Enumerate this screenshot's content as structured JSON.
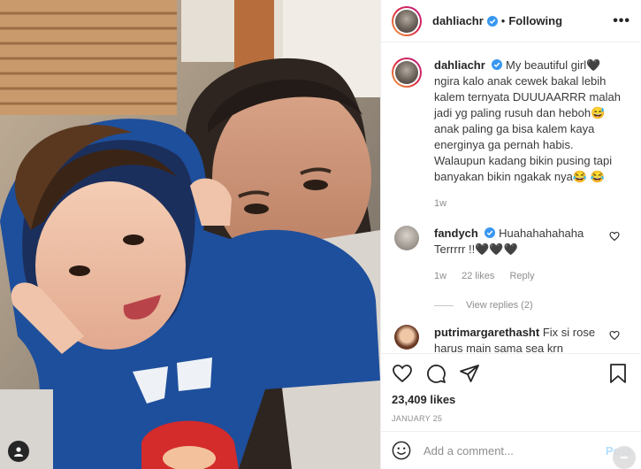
{
  "post": {
    "username": "dahliachr",
    "follow_status": "Following",
    "more_label": "•••",
    "caption": "My beautiful girl🖤 ngira kalo anak cewek bakal lebih kalem ternyata DUUUAARRR malah jadi yg paling rusuh dan heboh😅 anak paling ga bisa kalem kaya energinya ga pernah habis. Walaupun kadang bikin pusing tapi banyakan bikin ngakak nya😂 😂",
    "caption_time": "1w"
  },
  "comments": [
    {
      "username": "fandych",
      "text": "Huahahahahaha Terrrrr !!🖤🖤🖤",
      "time": "1w",
      "likes": "22 likes",
      "reply_label": "Reply",
      "view_replies": "View replies (2)"
    },
    {
      "username": "putrimargarethasht",
      "text": "Fix si rose harus main sama sea krn"
    }
  ],
  "actions": {
    "likes": "23,409 likes",
    "date": "JANUARY 25"
  },
  "comment_box": {
    "placeholder": "Add a comment...",
    "post_label": "Post"
  },
  "colors": {
    "verified": "#3897f0",
    "post_button": "#b2dffc",
    "meta_gray": "#8e8e8e"
  },
  "icons": [
    "heart-icon",
    "comment-icon",
    "share-icon",
    "bookmark-icon",
    "emoji-icon",
    "verified-icon",
    "tag-user-icon",
    "more-icon"
  ]
}
